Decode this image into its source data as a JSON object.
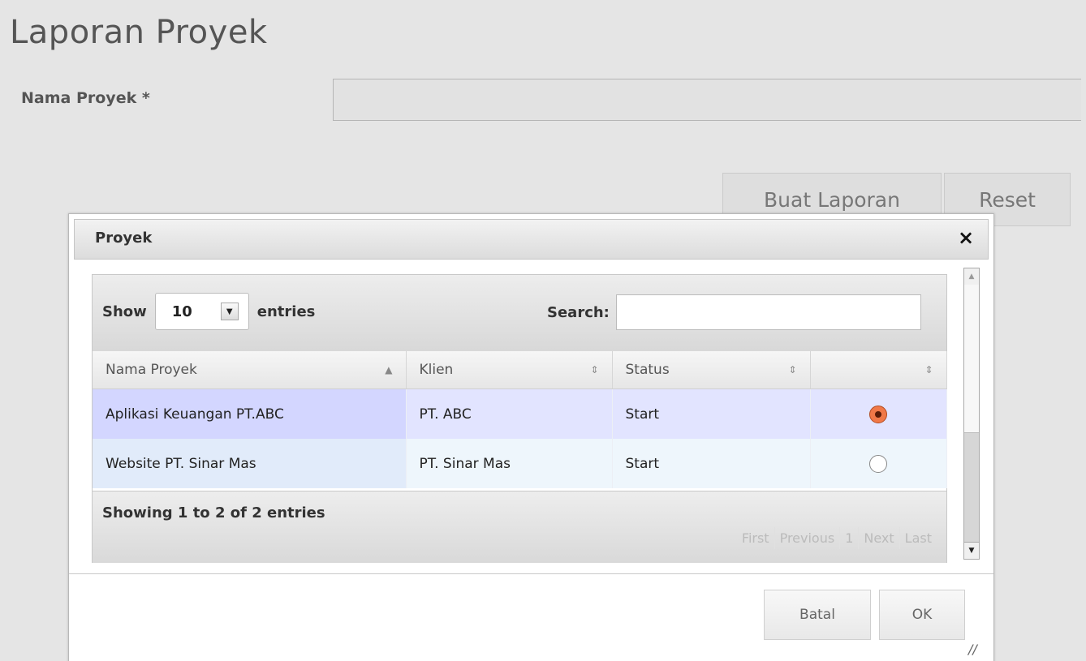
{
  "page": {
    "title": "Laporan Proyek",
    "field_label": "Nama Proyek *",
    "field_value": "",
    "buttons": {
      "generate": "Buat Laporan",
      "reset": "Reset"
    }
  },
  "dialog": {
    "title": "Proyek",
    "close_icon": "×",
    "length": {
      "prefix": "Show",
      "selected": "10",
      "suffix": "entries"
    },
    "search_label": "Search:",
    "search_value": "",
    "columns": [
      {
        "label": "Nama Proyek",
        "sort": "▲"
      },
      {
        "label": "Klien",
        "sort": "⇕"
      },
      {
        "label": "Status",
        "sort": "⇕"
      },
      {
        "label": "",
        "sort": "⇕"
      }
    ],
    "rows": [
      {
        "name": "Aplikasi Keuangan PT.ABC",
        "client": "PT. ABC",
        "status": "Start",
        "selected": true
      },
      {
        "name": "Website PT. Sinar Mas",
        "client": "PT. Sinar Mas",
        "status": "Start",
        "selected": false
      }
    ],
    "info": "Showing 1 to 2 of 2 entries",
    "pagination": {
      "first": "First",
      "previous": "Previous",
      "page": "1",
      "next": "Next",
      "last": "Last"
    },
    "buttons": {
      "cancel": "Batal",
      "ok": "OK"
    }
  },
  "colors": {
    "selected_row": "#e2e4ff",
    "radio_checked": "#f07848"
  }
}
